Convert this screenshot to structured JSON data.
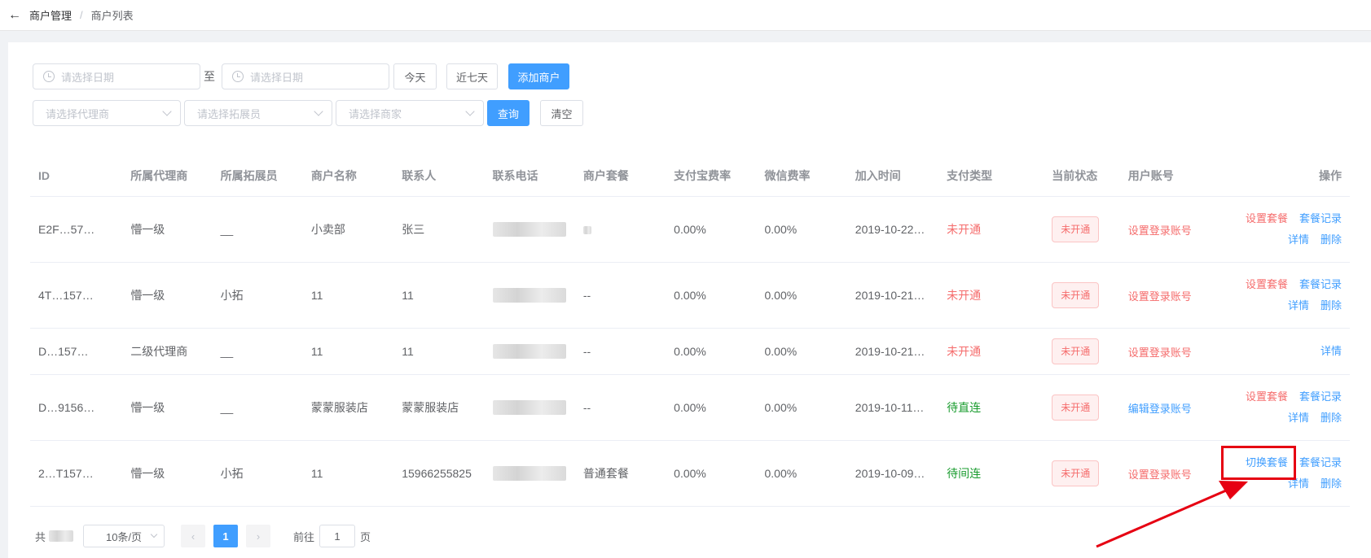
{
  "breadcrumb": {
    "back": "←",
    "parent": "商户管理",
    "sep": "/",
    "current": "商户列表"
  },
  "filters": {
    "start_date_placeholder": "请选择日期",
    "to_label": "至",
    "end_date_placeholder": "请选择日期",
    "today_label": "今天",
    "last7_label": "近七天",
    "add_label": "添加商户",
    "agent_placeholder": "请选择代理商",
    "promoter_placeholder": "请选择拓展员",
    "merchant_placeholder": "请选择商家",
    "query_label": "查询",
    "clear_label": "清空"
  },
  "table": {
    "headers": [
      "ID",
      "所属代理商",
      "所属拓展员",
      "商户名称",
      "联系人",
      "联系电话",
      "商户套餐",
      "支付宝费率",
      "微信费率",
      "加入时间",
      "支付类型",
      "当前状态",
      "用户账号",
      "操作"
    ],
    "rows": [
      {
        "id": "E2F…57…",
        "agent": "懵一级",
        "promoter": "__",
        "name": "小卖部",
        "contact": "张三",
        "phone": "",
        "package": "",
        "alipay": "0.00%",
        "wechat": "0.00%",
        "joined": "2019-10-22…",
        "pay_type": "未开通",
        "status": "未开通",
        "account": "设置登录账号",
        "ops_top": [
          "设置套餐",
          "套餐记录"
        ],
        "ops_bottom": [
          "详情",
          "删除"
        ]
      },
      {
        "id": "4T…157…",
        "agent": "懵一级",
        "promoter": "小拓",
        "name": "11",
        "contact": "11",
        "phone": "",
        "package": "--",
        "alipay": "0.00%",
        "wechat": "0.00%",
        "joined": "2019-10-21…",
        "pay_type": "未开通",
        "status": "未开通",
        "account": "设置登录账号",
        "ops_top": [
          "设置套餐",
          "套餐记录"
        ],
        "ops_bottom": [
          "详情",
          "删除"
        ]
      },
      {
        "id": "D…157…",
        "agent": "二级代理商",
        "promoter": "__",
        "name": "11",
        "contact": "11",
        "phone": "",
        "package": "--",
        "alipay": "0.00%",
        "wechat": "0.00%",
        "joined": "2019-10-21…",
        "pay_type": "未开通",
        "status": "未开通",
        "account": "设置登录账号",
        "ops_top": [],
        "ops_bottom": [
          "详情"
        ]
      },
      {
        "id": "D…9156…",
        "agent": "懵一级",
        "promoter": "__",
        "name": "蒙蒙服装店",
        "contact": "蒙蒙服装店",
        "phone": "",
        "package": "--",
        "alipay": "0.00%",
        "wechat": "0.00%",
        "joined": "2019-10-11…",
        "pay_type": "待直连",
        "status": "未开通",
        "account": "编辑登录账号",
        "ops_top": [
          "设置套餐",
          "套餐记录"
        ],
        "ops_bottom": [
          "详情",
          "删除"
        ]
      },
      {
        "id": "2…T157…",
        "agent": "懵一级",
        "promoter": "小拓",
        "name": "11",
        "contact": "15966255825",
        "phone": "",
        "package": "普通套餐",
        "alipay": "0.00%",
        "wechat": "0.00%",
        "joined": "2019-10-09…",
        "pay_type": "待间连",
        "status": "未开通",
        "account": "设置登录账号",
        "ops_top": [
          "切换套餐",
          "套餐记录"
        ],
        "ops_bottom": [
          "详情",
          "删除"
        ]
      }
    ]
  },
  "pagination": {
    "total_prefix": "共",
    "page_size": "10条/页",
    "prev": "‹",
    "current_page": "1",
    "next": "›",
    "goto_label": "前往",
    "goto_value": "1",
    "page_suffix": "页"
  },
  "colors": {
    "primary": "#409eff",
    "danger": "#f56c6c",
    "success": "#1a9c2f",
    "annotation": "#e60012"
  },
  "icons": {
    "back": "arrow-left-icon",
    "date": "clock-icon",
    "select": "chevron-down-icon"
  }
}
